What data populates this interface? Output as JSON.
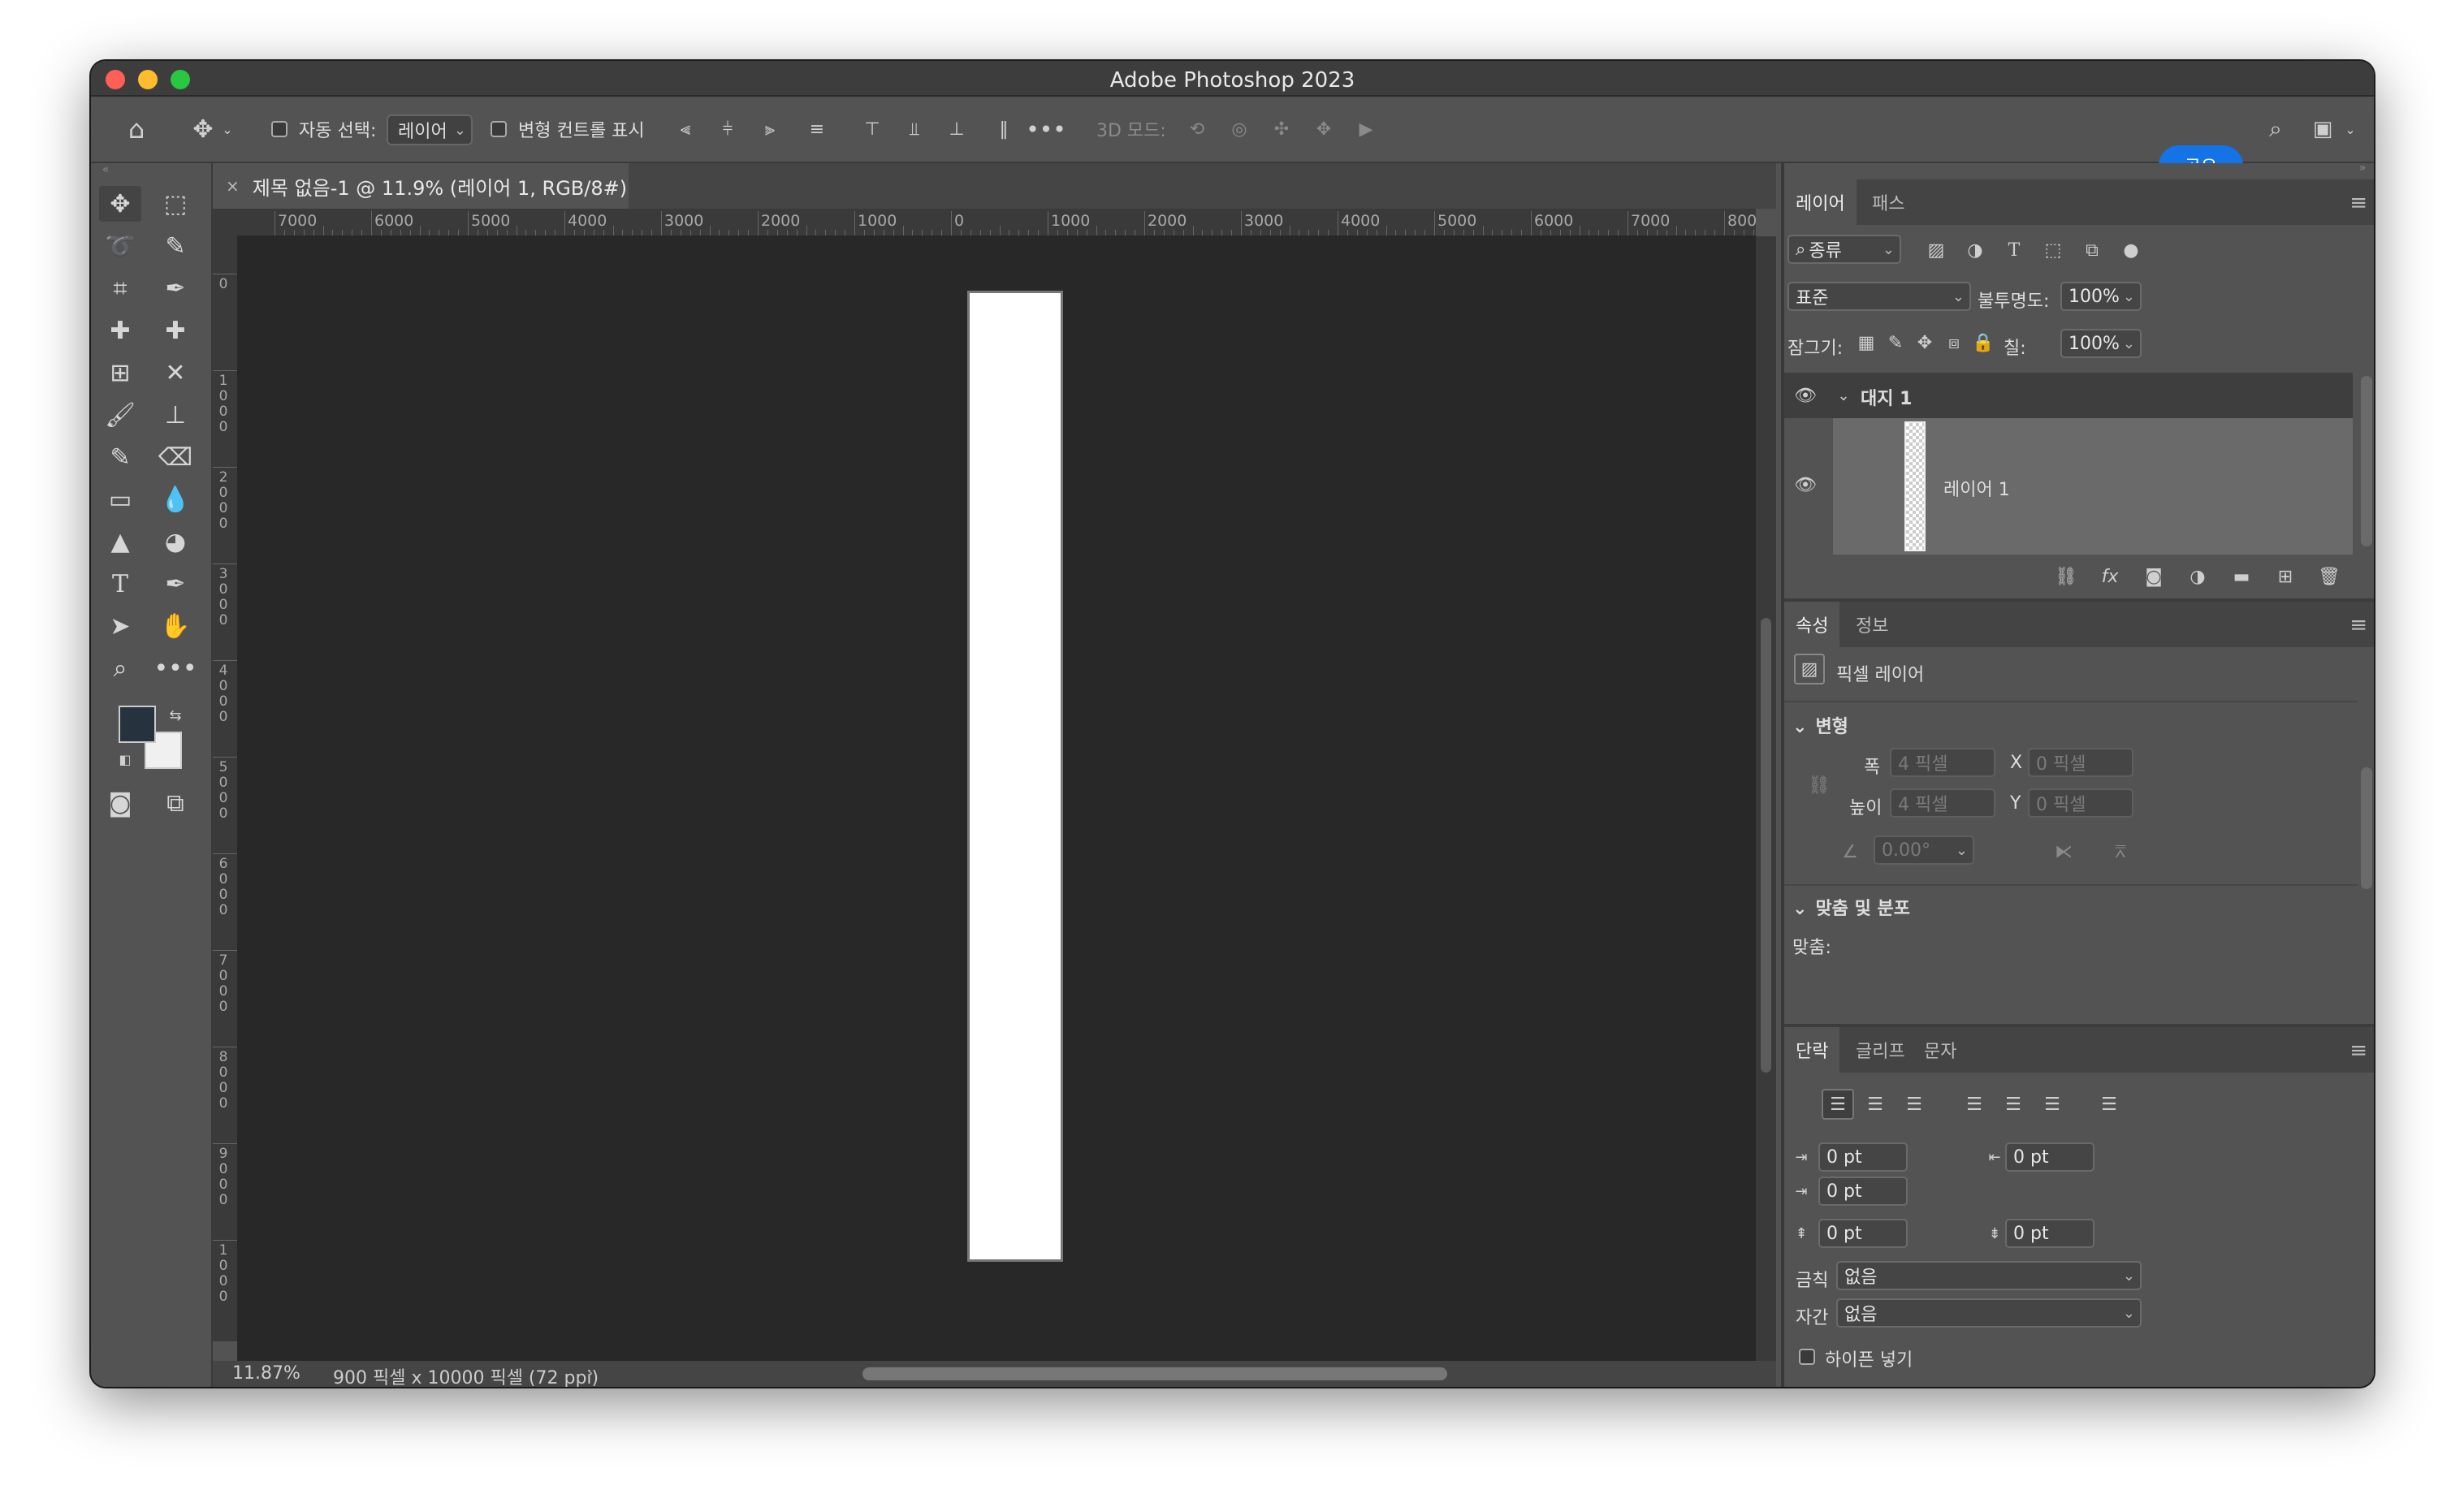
{
  "window": {
    "title": "Adobe Photoshop 2023"
  },
  "options_bar": {
    "auto_select_label": "자동 선택:",
    "auto_select_value": "레이어",
    "transform_controls_label": "변형 컨트롤 표시",
    "mode_3d_label": "3D 모드:",
    "share_label": "공유"
  },
  "document": {
    "tab_title": "제목 없음-1 @ 11.9% (레이어 1, RGB/8#)",
    "h_ruler_labels": [
      "7000",
      "6000",
      "5000",
      "4000",
      "3000",
      "2000",
      "1000",
      "0",
      "1000",
      "2000",
      "3000",
      "4000",
      "5000",
      "6000",
      "7000",
      "800"
    ],
    "v_ruler_labels": [
      "0",
      "1000",
      "2000",
      "3000",
      "4000",
      "5000",
      "6000",
      "7000",
      "8000",
      "9000",
      "1000"
    ],
    "zoom": "11.87%",
    "doc_info": "900 픽셀 x 10000 픽셀 (72 ppi)"
  },
  "colors": {
    "foreground": "#27323f",
    "background": "#f0f0f0",
    "accent": "#1473e6"
  },
  "layers_panel": {
    "tabs": [
      "레이어",
      "패스"
    ],
    "filter_value": "종류",
    "blend_mode": "표준",
    "opacity_label": "불투명도:",
    "opacity_value": "100%",
    "lock_label": "잠그기:",
    "fill_label": "칠:",
    "fill_value": "100%",
    "artboard_name": "대지 1",
    "layer_name": "레이어 1"
  },
  "properties_panel": {
    "tabs": [
      "속성",
      "정보"
    ],
    "layer_type": "픽셀 레이어",
    "transform_header": "변형",
    "width_label": "폭",
    "width_value": "4 픽셀",
    "x_label": "X",
    "x_value": "0 픽셀",
    "height_label": "높이",
    "height_value": "4 픽셀",
    "y_label": "Y",
    "y_value": "0 픽셀",
    "angle_value": "0.00°",
    "align_header": "맞춤 및 분포",
    "align_label": "맞춤:"
  },
  "paragraph_panel": {
    "tabs": [
      "단락",
      "글리프",
      "문자"
    ],
    "indent_left": "0 pt",
    "indent_right": "0 pt",
    "indent_first": "0 pt",
    "space_before": "0 pt",
    "space_after": "0 pt",
    "kinsoku_label": "금칙",
    "kinsoku_value": "없음",
    "mojikumi_label": "자간",
    "mojikumi_value": "없음",
    "hyphenate_label": "하이픈 넣기"
  }
}
